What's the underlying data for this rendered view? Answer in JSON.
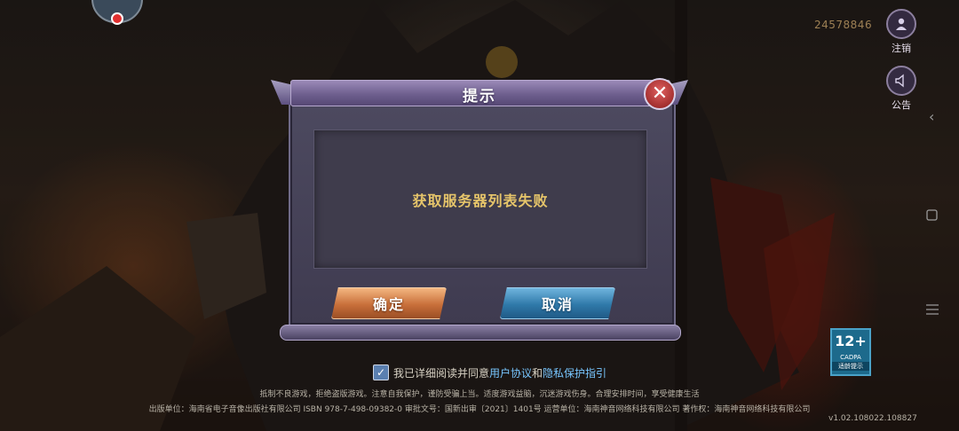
{
  "top": {
    "uid": "24578846"
  },
  "side": {
    "login_label": "注销",
    "notice_label": "公告"
  },
  "dialog": {
    "title": "提示",
    "message": "获取服务器列表失败",
    "ok_label": "确定",
    "cancel_label": "取消",
    "close_glyph": "✕"
  },
  "agreement": {
    "prefix": "我已详细阅读并同意",
    "user_agreement": "用户协议",
    "and": "和",
    "privacy": "隐私保护指引"
  },
  "legal": {
    "line1": "抵制不良游戏，拒绝盗版游戏。注意自我保护，谨防受骗上当。适度游戏益脑，沉迷游戏伤身。合理安排时间，享受健康生活",
    "line2": "出版单位：海南省电子音像出版社有限公司 ISBN 978-7-498-09382-0 审批文号：国新出审〔2021〕1401号 运营单位：海南神音网络科技有限公司 著作权：海南神音网络科技有限公司",
    "version": "v1.02.108022.108827"
  },
  "age_badge": {
    "number": "12+",
    "org": "CADPA",
    "caption": "适龄提示"
  },
  "icons": [
    "avatar-icon",
    "user-icon",
    "speaker-icon",
    "close-icon",
    "check-icon"
  ],
  "colors": {
    "accent_gold": "#e6c56a",
    "ok_button": "#c86f3a",
    "cancel_button": "#2f79a9",
    "link": "#78c6ff"
  }
}
